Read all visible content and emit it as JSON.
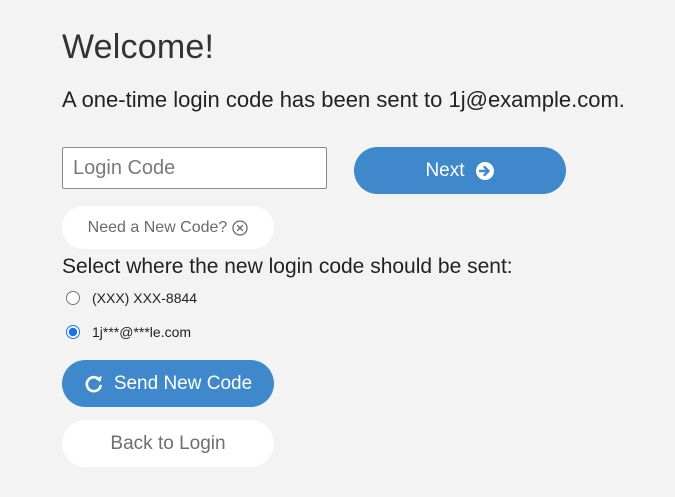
{
  "header": {
    "title": "Welcome!",
    "subtitle": "A one-time login code has been sent to 1j@example.com."
  },
  "login_code": {
    "placeholder": "Login Code",
    "value": ""
  },
  "next_button": {
    "label": "Next",
    "icon": "arrow-right-circle-icon"
  },
  "new_code_button": {
    "label": "Need a New Code?",
    "icon": "close-circle-icon"
  },
  "delivery": {
    "prompt": "Select where the new login code should be sent:",
    "options": [
      {
        "label": "(XXX) XXX-8844",
        "selected": false
      },
      {
        "label": "1j***@***le.com",
        "selected": true
      }
    ]
  },
  "send_button": {
    "label": "Send New Code",
    "icon": "refresh-icon"
  },
  "back_button": {
    "label": "Back to Login"
  },
  "colors": {
    "background": "#f3f3f3",
    "primary": "#3f88cc",
    "button_light": "#ffffff",
    "radio_accent": "#1a73e8"
  }
}
